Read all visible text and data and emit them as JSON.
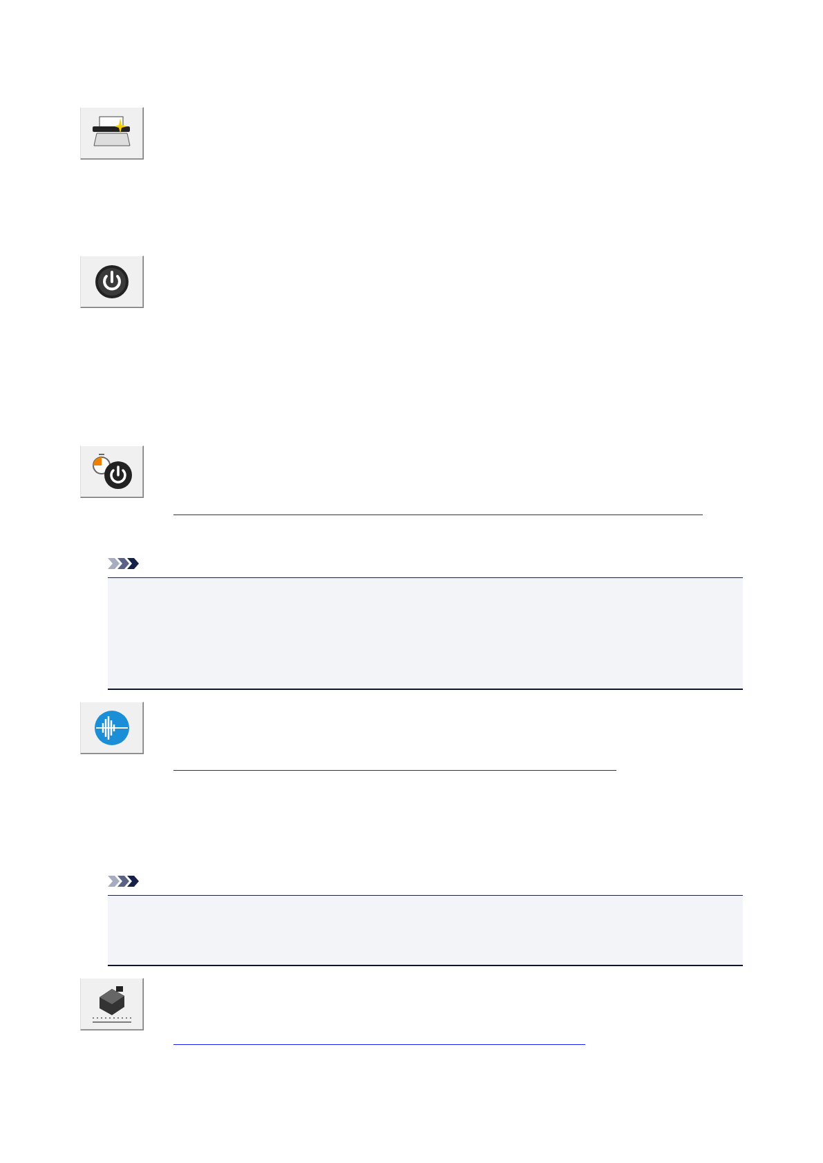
{
  "blocks": [
    {
      "kind": "printer-button"
    },
    {
      "kind": "power-button"
    },
    {
      "kind": "timer-button"
    },
    {
      "kind": "link-line"
    },
    {
      "kind": "note"
    },
    {
      "kind": "sound-button"
    },
    {
      "kind": "link-line"
    },
    {
      "kind": "note"
    },
    {
      "kind": "ink-button"
    },
    {
      "kind": "link-line"
    }
  ]
}
